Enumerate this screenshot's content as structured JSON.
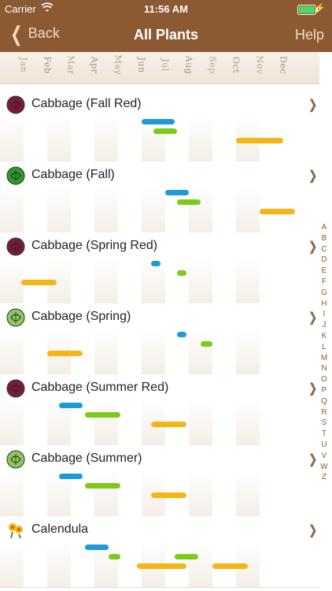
{
  "status": {
    "carrier": "Carrier",
    "time": "11:56 AM"
  },
  "nav": {
    "back": "Back",
    "title": "All Plants",
    "help": "Help"
  },
  "months": [
    "Jan",
    "Feb",
    "Mar",
    "Apr",
    "May",
    "Jun",
    "Jul",
    "Aug",
    "Sep",
    "Oct",
    "Nov",
    "Dec"
  ],
  "index": [
    "A",
    "B",
    "C",
    "D",
    "E",
    "F",
    "G",
    "H",
    "I",
    "J",
    "K",
    "L",
    "M",
    "N",
    "O",
    "P",
    "Q",
    "R",
    "S",
    "T",
    "U",
    "V",
    "W",
    "Z"
  ],
  "colors": {
    "nav": "#8b5a33",
    "blue": "#1e9bd7",
    "green": "#7ccb1a",
    "orange": "#f6b416",
    "redcab": "#7a1b3c",
    "greencab": "#2f9a2a"
  },
  "plants": [
    {
      "name": "Cabbage (Fall Red)",
      "icon": "cabbage-red-icon",
      "bars": [
        {
          "color": "blue",
          "start": 6.0,
          "end": 7.4,
          "row": 0
        },
        {
          "color": "green",
          "start": 6.5,
          "end": 7.5,
          "row": 1
        },
        {
          "color": "orange",
          "start": 10.0,
          "end": 12.0,
          "row": 2
        }
      ]
    },
    {
      "name": "Cabbage (Fall)",
      "icon": "cabbage-green-icon",
      "bars": [
        {
          "color": "blue",
          "start": 7.0,
          "end": 8.0,
          "row": 0
        },
        {
          "color": "green",
          "start": 7.5,
          "end": 8.5,
          "row": 1
        },
        {
          "color": "orange",
          "start": 11.0,
          "end": 12.5,
          "row": 2
        }
      ]
    },
    {
      "name": "Cabbage (Spring Red)",
      "icon": "cabbage-red-icon",
      "bars": [
        {
          "color": "blue",
          "start": 6.4,
          "end": 6.8,
          "row": 0
        },
        {
          "color": "green",
          "start": 7.5,
          "end": 7.9,
          "row": 1
        },
        {
          "color": "orange",
          "start": 0.9,
          "end": 2.4,
          "row": 2
        }
      ]
    },
    {
      "name": "Cabbage (Spring)",
      "icon": "cabbage-lightgreen-icon",
      "bars": [
        {
          "color": "blue",
          "start": 7.5,
          "end": 7.9,
          "row": 0
        },
        {
          "color": "green",
          "start": 8.5,
          "end": 9.0,
          "row": 1
        },
        {
          "color": "orange",
          "start": 2.0,
          "end": 3.5,
          "row": 2
        }
      ]
    },
    {
      "name": "Cabbage (Summer Red)",
      "icon": "cabbage-red-icon",
      "bars": [
        {
          "color": "blue",
          "start": 2.5,
          "end": 3.5,
          "row": 0
        },
        {
          "color": "green",
          "start": 3.6,
          "end": 5.1,
          "row": 1
        },
        {
          "color": "orange",
          "start": 6.4,
          "end": 7.9,
          "row": 2
        }
      ]
    },
    {
      "name": "Cabbage (Summer)",
      "icon": "cabbage-lightgreen-icon",
      "bars": [
        {
          "color": "blue",
          "start": 2.5,
          "end": 3.5,
          "row": 0
        },
        {
          "color": "green",
          "start": 3.6,
          "end": 5.1,
          "row": 1
        },
        {
          "color": "orange",
          "start": 6.4,
          "end": 7.9,
          "row": 2
        }
      ]
    },
    {
      "name": "Calendula",
      "icon": "calendula-flower-icon",
      "bars": [
        {
          "color": "blue",
          "start": 3.6,
          "end": 4.6,
          "row": 0
        },
        {
          "color": "green",
          "start": 4.6,
          "end": 5.1,
          "row": 1
        },
        {
          "color": "green",
          "start": 7.4,
          "end": 8.4,
          "row": 1
        },
        {
          "color": "orange",
          "start": 5.8,
          "end": 7.9,
          "row": 2
        },
        {
          "color": "orange",
          "start": 9.0,
          "end": 10.5,
          "row": 2
        }
      ]
    }
  ]
}
